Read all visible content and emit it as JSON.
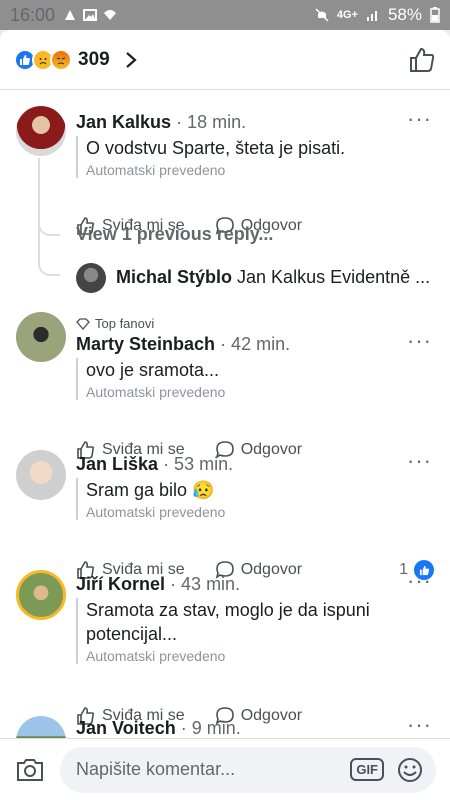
{
  "status_bar": {
    "time": "16:00",
    "network": "4G+",
    "battery": "58%"
  },
  "reactions": {
    "count": "309"
  },
  "comments": [
    {
      "name": "Jan Kalkus",
      "time": "· 18 min.",
      "text": "O vodstvu Sparte, šteta je pisati.",
      "translated": "Automatski prevedeno",
      "like": "Sviđa mi se",
      "reply": "Odgovor"
    },
    {
      "name": "Marty Steinbach",
      "time": "· 42 min.",
      "badge": "Top fanovi",
      "text": "ovo je sramota...",
      "translated": "Automatski prevedeno",
      "like": "Sviđa mi se",
      "reply": "Odgovor"
    },
    {
      "name": "Jan Liška",
      "time": "· 53 min.",
      "text": "Sram ga bilo 😥",
      "translated": "Automatski prevedeno",
      "like": "Sviđa mi se",
      "reply": "Odgovor",
      "like_count": "1"
    },
    {
      "name": "Jiří Kornel",
      "time": "· 43 min.",
      "text": "Sramota za stav, moglo je da ispuni potencijal...",
      "translated": "Automatski prevedeno",
      "like": "Sviđa mi se",
      "reply": "Odgovor"
    },
    {
      "name": "Jan Voitech",
      "time": "· 9 min."
    }
  ],
  "thread": {
    "view_previous": "View 1 previous reply...",
    "reply_name": "Michal Stýblo",
    "reply_text": "Jan Kalkus Evidentně ..."
  },
  "composer": {
    "placeholder": "Napišite komentar...",
    "gif_label": "GIF"
  }
}
